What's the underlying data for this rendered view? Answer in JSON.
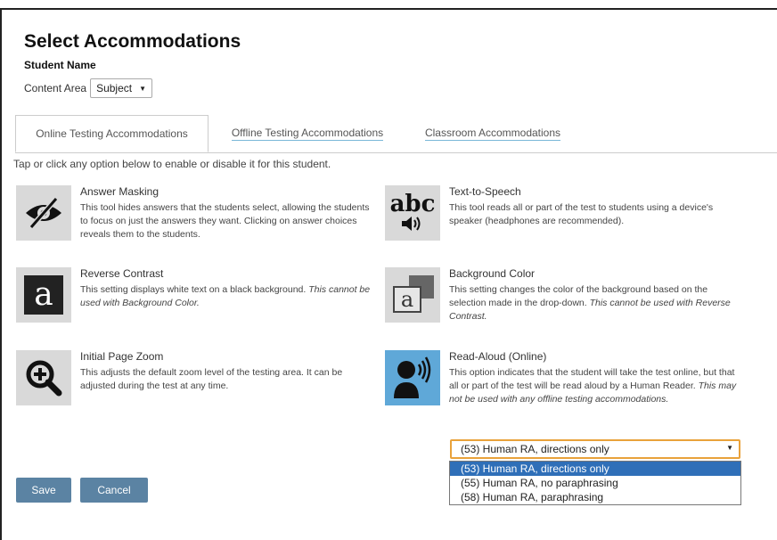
{
  "page": {
    "title": "Select Accommodations",
    "student_name": "Student Name",
    "content_area_label": "Content Area",
    "subject_value": "Subject"
  },
  "tabs": [
    {
      "label": "Online Testing Accommodations",
      "active": true
    },
    {
      "label": "Offline Testing Accommodations",
      "active": false
    },
    {
      "label": "Classroom Accommodations",
      "active": false
    }
  ],
  "instructions": "Tap or click any option below to enable or disable it for this student.",
  "accommodations": {
    "answer_masking": {
      "name": "Answer Masking",
      "desc": "This tool hides answers that the students select, allowing the students to focus on just the answers they want. Clicking on answer choices reveals them to the students.",
      "icon": "eye-slash-icon"
    },
    "text_to_speech": {
      "name": "Text-to-Speech",
      "desc": "This tool reads all or part of the test to students using a device's speaker (headphones are recommended).",
      "icon": "abc-speaker-icon",
      "icon_text": "abc"
    },
    "reverse_contrast": {
      "name": "Reverse Contrast",
      "desc": "This setting displays white text on a black background. ",
      "desc_italic": "This cannot be used with Background Color.",
      "icon": "reverse-contrast-icon",
      "icon_text": "a"
    },
    "background_color": {
      "name": "Background Color",
      "desc": "This setting changes the color of the background based on the selection made in the drop-down. ",
      "desc_italic": "This cannot be used with Reverse Contrast.",
      "icon": "background-color-icon",
      "icon_text": "a"
    },
    "initial_page_zoom": {
      "name": "Initial Page Zoom",
      "desc": "This adjusts the default zoom level of the testing area. It can be adjusted during the test at any time.",
      "icon": "zoom-in-icon"
    },
    "read_aloud": {
      "name": "Read-Aloud (Online)",
      "desc": "This option indicates that the student will take the test online, but that all or part of the test will be read aloud by a Human Reader. ",
      "desc_italic": "This may not be used with any offline testing accommodations.",
      "icon": "speaking-person-icon",
      "selected": true
    }
  },
  "read_aloud_dropdown": {
    "value": "(53) Human RA, directions only",
    "options": [
      "(53) Human RA, directions only",
      "(55) Human RA, no paraphrasing",
      "(58) Human RA, paraphrasing"
    ]
  },
  "buttons": {
    "save": "Save",
    "cancel": "Cancel"
  },
  "colors": {
    "button_bg": "#5b83a3",
    "icon_bg": "#d9d9d9",
    "selected_icon_bg": "#5fa8d8",
    "dropdown_focus": "#e9a23b",
    "option_highlight": "#2f6fb8"
  }
}
